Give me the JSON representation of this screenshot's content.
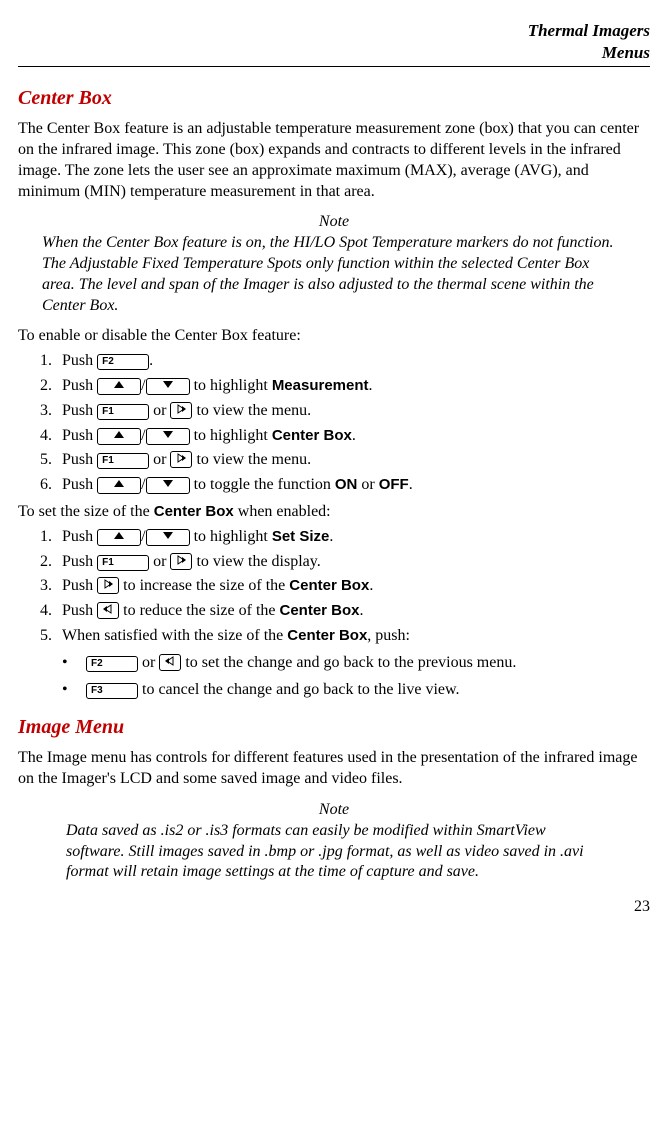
{
  "header": {
    "line1": "Thermal Imagers",
    "line2": "Menus"
  },
  "section1": {
    "title": "Center Box",
    "para1": "The Center Box feature is an adjustable temperature measurement zone (box) that you can center on the infrared image. This zone (box) expands and contracts to different levels in the infrared image. The zone lets the user see an approximate maximum (MAX), average (AVG), and minimum (MIN) temperature measurement in that area.",
    "note_label": "Note",
    "note_body": "When the Center Box feature is on, the HI/LO Spot Temperature markers do not function. The Adjustable Fixed Temperature Spots only function within the selected Center Box area. The level and span of the Imager is also adjusted to the thermal scene within the Center Box.",
    "intro1": "To enable or disable the Center Box feature:",
    "steps1": {
      "s1a": "Push ",
      "s1b": ".",
      "s2a": "Push ",
      "s2b": "/",
      "s2c": " to highlight ",
      "s2d": "Measurement",
      "s2e": ".",
      "s3a": "Push ",
      "s3b": " or ",
      "s3c": " to view the menu.",
      "s4a": "Push ",
      "s4b": "/",
      "s4c": " to highlight ",
      "s4d": "Center Box",
      "s4e": ".",
      "s5a": "Push ",
      "s5b": " or ",
      "s5c": " to view the menu.",
      "s6a": "Push ",
      "s6b": "/",
      "s6c": " to toggle the function ",
      "s6d": "ON",
      "s6e": " or ",
      "s6f": "OFF",
      "s6g": "."
    },
    "intro2_a": "To set the size of the ",
    "intro2_b": "Center Box",
    "intro2_c": " when enabled:",
    "steps2": {
      "s1a": "Push ",
      "s1b": "/",
      "s1c": " to highlight ",
      "s1d": "Set Size",
      "s1e": ".",
      "s2a": "Push ",
      "s2b": " or ",
      "s2c": " to view the display.",
      "s3a": "Push ",
      "s3b": " to increase the size of the ",
      "s3c": "Center Box",
      "s3d": ".",
      "s4a": "Push ",
      "s4b": " to reduce the size of the ",
      "s4c": "Center Box",
      "s4d": ".",
      "s5a": "When satisfied with the size of the ",
      "s5b": "Center Box",
      "s5c": ", push:"
    },
    "bullets": {
      "b1a": " or ",
      "b1b": " to set the change and go back to the previous menu.",
      "b2a": " to cancel the change and go back to the live view."
    }
  },
  "buttons": {
    "f1": "F1",
    "f2": "F2",
    "f3": "F3"
  },
  "section2": {
    "title": "Image Menu",
    "para1": "The Image menu has controls for different features used in the presentation of the infrared image on the Imager's LCD and some saved image and video files.",
    "note_label": "Note",
    "note_body": "Data saved as .is2 or .is3 formats can easily be modified within SmartView software. Still images saved in .bmp or .jpg format, as well as video saved in .avi format will retain image settings at the time of capture and save."
  },
  "page_number": "23"
}
